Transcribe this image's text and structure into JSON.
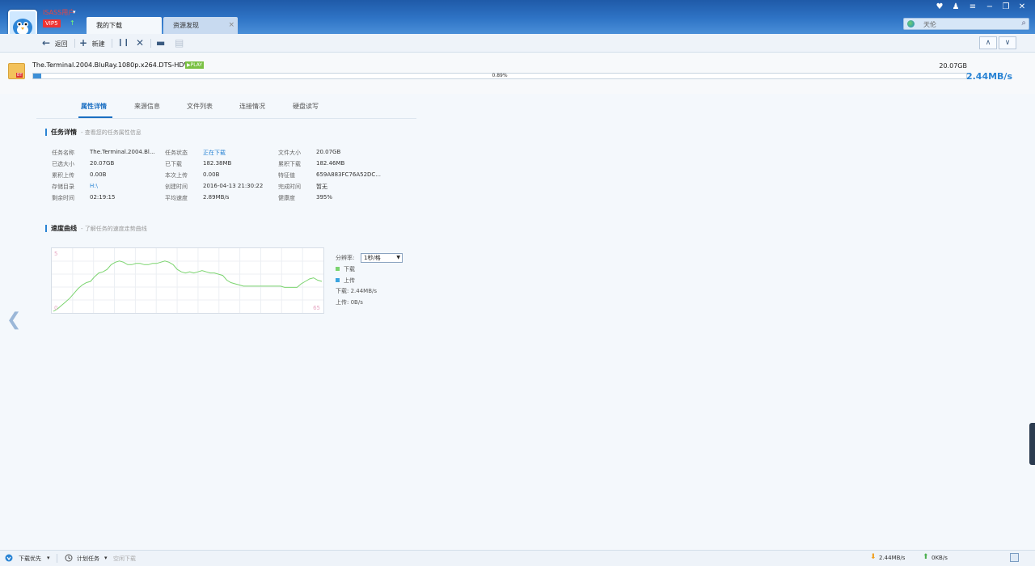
{
  "user": {
    "name": "ISASS用户",
    "vip": "VIP5",
    "vip_arrow": "↑"
  },
  "tabs": [
    {
      "label": "我的下载"
    },
    {
      "label": "资源发现",
      "close": "×"
    }
  ],
  "window_controls": {
    "skin": "♥",
    "user": "♟",
    "menu": "≡",
    "minimize": "−",
    "restore": "❐",
    "close": "✕"
  },
  "search": {
    "placeholder": "天伦",
    "icon": "⌕"
  },
  "toolbar": {
    "back_label": "返回",
    "back_icon": "←",
    "new_label": "新建",
    "new_icon": "+",
    "pause_icon": "❙❙",
    "delete_icon": "✕",
    "folder_icon": "▬",
    "doc_icon": "▤",
    "up_icon": "∧",
    "down_icon": "∨"
  },
  "task": {
    "badge": "BT",
    "name": "The.Terminal.2004.BluRay.1080p.x264.DTS-HDWinG",
    "play": "▶PLAY",
    "size": "20.07GB",
    "progress_percent": 0.89,
    "progress_label": "0.89%",
    "speed": "2.44MB/s"
  },
  "subtabs": [
    "属性详情",
    "来源信息",
    "文件列表",
    "连接情况",
    "硬盘读写"
  ],
  "details_section": {
    "title": "任务详情",
    "desc": "- 查看您的任务属性信息"
  },
  "details": [
    [
      "任务名称",
      "The.Terminal.2004.Bl...",
      "任务状态",
      "正在下载",
      "文件大小",
      "20.07GB"
    ],
    [
      "已选大小",
      "20.07GB",
      "已下载",
      "182.38MB",
      "累积下载",
      "182.46MB"
    ],
    [
      "累积上传",
      "0.00B",
      "本次上传",
      "0.00B",
      "特征值",
      "659A883FC76A52DC..."
    ],
    [
      "存储目录",
      "H:\\",
      "创建时间",
      "2016-04-13 21:30:22",
      "完成时间",
      "暂无"
    ],
    [
      "剩余时间",
      "02:19:15",
      "平均速度",
      "2.89MB/s",
      "健康度",
      "395%"
    ]
  ],
  "speed_section": {
    "title": "速度曲线",
    "desc": "- 了解任务的速度走势曲线"
  },
  "chart_data": {
    "type": "line",
    "corner_labels": {
      "top_left": "5",
      "bottom_left": "0",
      "bottom_right": "65"
    },
    "ylim": [
      0,
      5
    ],
    "series": [
      {
        "name": "下载",
        "color": "#7bd46f",
        "x": [
          0,
          1,
          2,
          3,
          4,
          5,
          6,
          7,
          8,
          9,
          10,
          11,
          12,
          13,
          14,
          15,
          16,
          17,
          18,
          19,
          20,
          21,
          22,
          23,
          24,
          25,
          26,
          27,
          28,
          29,
          30,
          31,
          32,
          33,
          34,
          35,
          36,
          37,
          38,
          39,
          40,
          41,
          42,
          43,
          44,
          45,
          46,
          47,
          48,
          49,
          50,
          51,
          52,
          53,
          54,
          55,
          56,
          57,
          58,
          59,
          60,
          61,
          62,
          63,
          64,
          65
        ],
        "values": [
          0.0,
          0.2,
          0.5,
          0.8,
          1.1,
          1.5,
          1.9,
          2.2,
          2.4,
          2.5,
          2.9,
          3.2,
          3.3,
          3.5,
          3.9,
          4.1,
          4.2,
          4.1,
          3.9,
          3.9,
          4.0,
          4.0,
          3.9,
          3.9,
          4.0,
          4.0,
          4.1,
          4.2,
          4.1,
          3.9,
          3.5,
          3.3,
          3.2,
          3.3,
          3.2,
          3.3,
          3.4,
          3.3,
          3.2,
          3.2,
          3.1,
          3.0,
          2.6,
          2.4,
          2.3,
          2.2,
          2.1,
          2.1,
          2.1,
          2.1,
          2.1,
          2.1,
          2.1,
          2.1,
          2.1,
          2.1,
          2.0,
          2.0,
          2.0,
          2.0,
          2.3,
          2.5,
          2.7,
          2.8,
          2.6,
          2.5
        ]
      },
      {
        "name": "上传",
        "color": "#3aa4df",
        "values": []
      }
    ],
    "resolution_label": "分辨率:",
    "resolution_value": "1秒/格",
    "download_rate": "下载: 2.44MB/s",
    "upload_rate": "上传: 0B/s"
  },
  "statusbar": {
    "priority": "下载优先",
    "plan": "计划任务",
    "idle": "空闲下载",
    "down_speed": "2.44MB/s",
    "up_speed": "0KB/s"
  }
}
